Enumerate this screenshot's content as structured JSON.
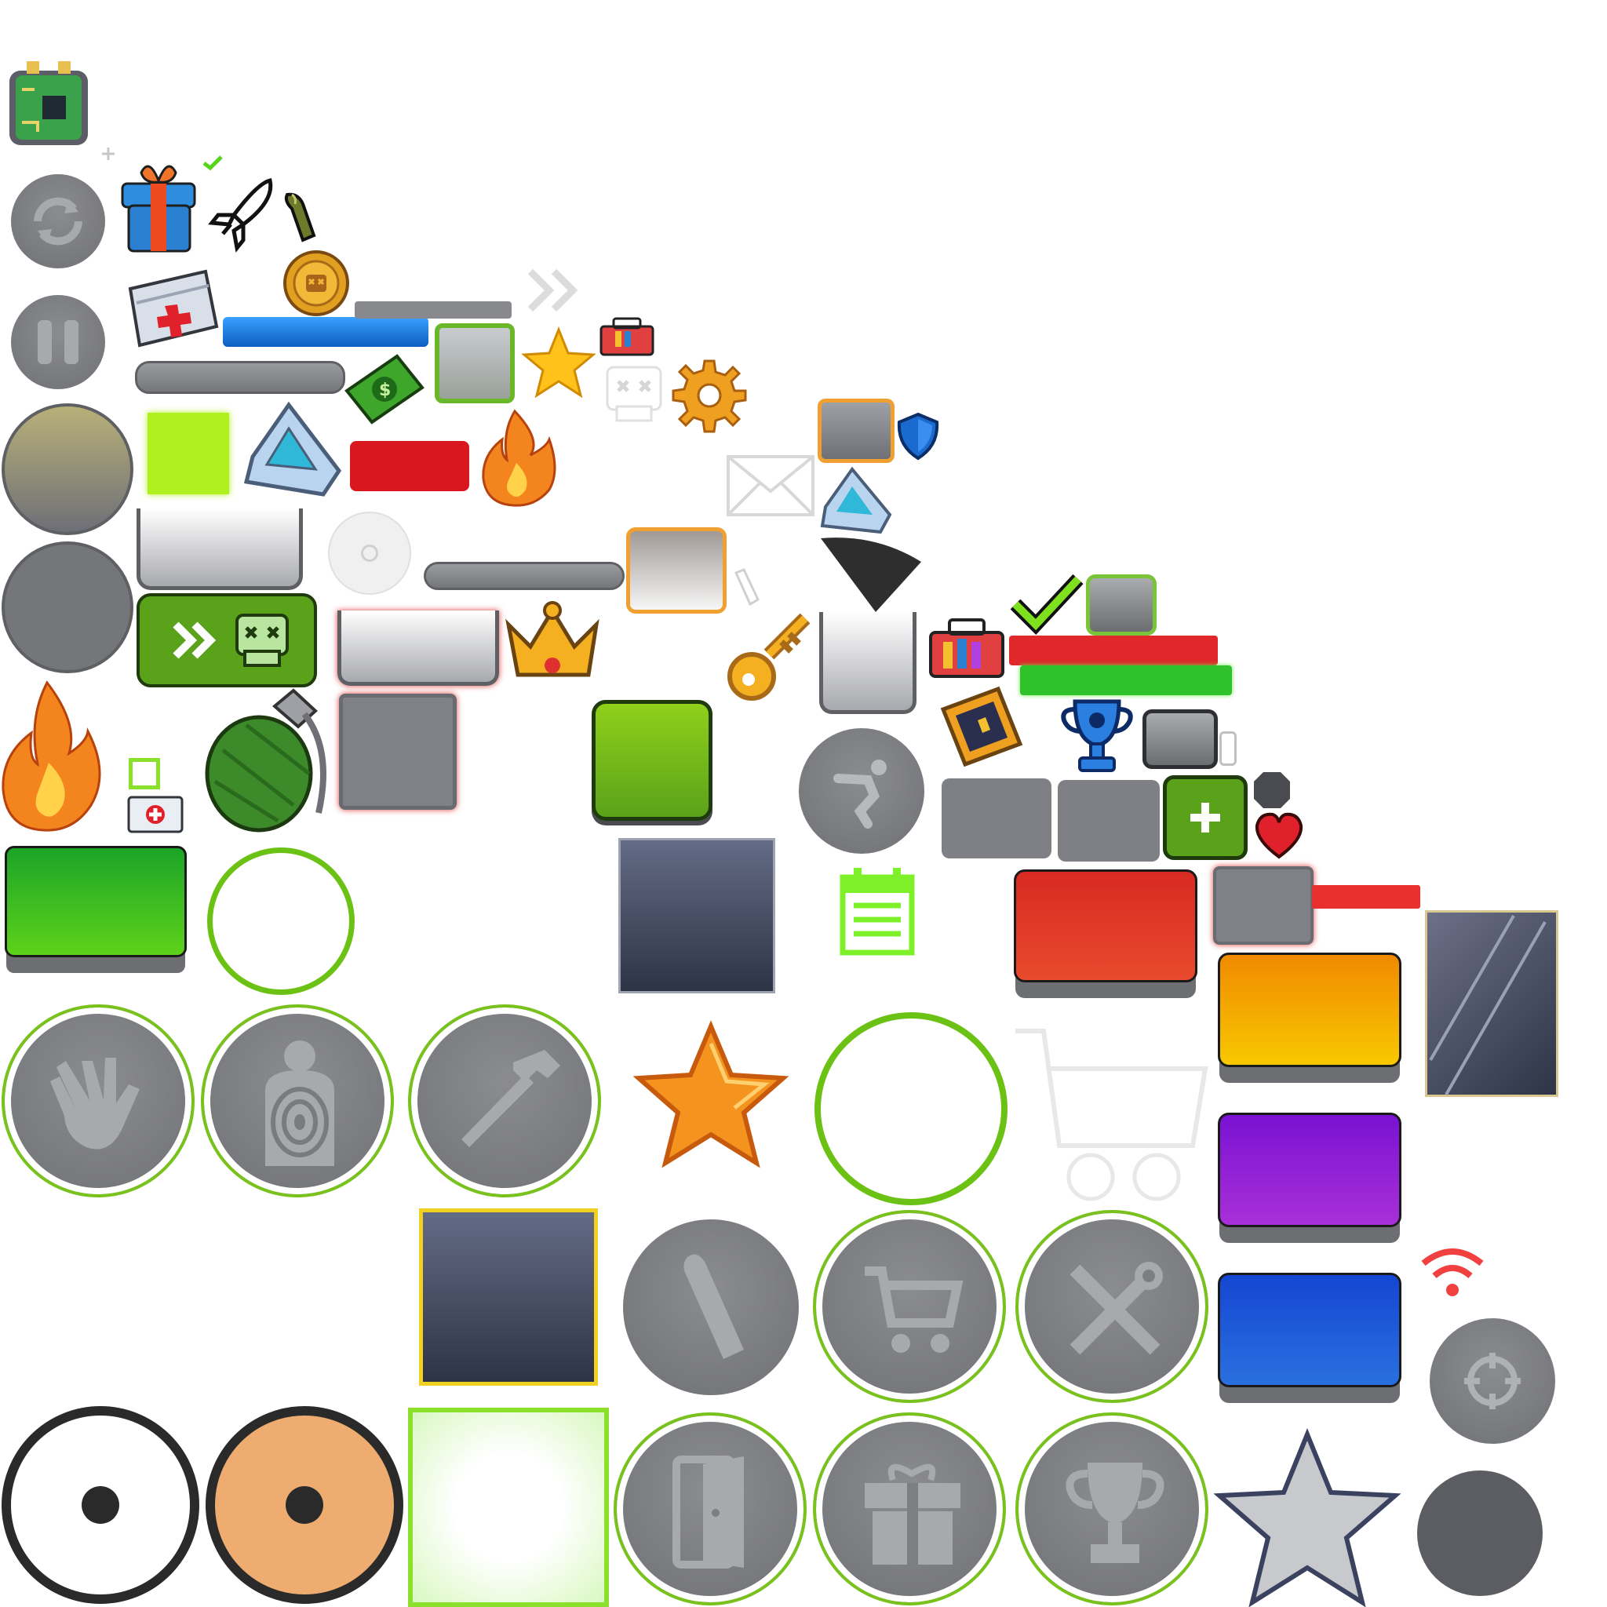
{
  "sheet": {
    "title": "",
    "colors": {
      "accent_green": "#79c21e",
      "button_grey": "#7d7e82",
      "panel_red": "#e02a22",
      "panel_orange": "#f5a300",
      "panel_purple": "#8a1fd0",
      "panel_blue": "#1c5fd6",
      "panel_green": "#2fb82a",
      "dark_slate": "#3a3f52"
    }
  },
  "icons": [
    "circuit-board-icon",
    "gift-icon",
    "rocket-icon",
    "bullet-icon",
    "checkmark-icon",
    "coin-skull-icon",
    "refresh-icon",
    "pause-icon",
    "medkit-icon",
    "blue-progress-bar",
    "grey-progress-bar",
    "cash-icon",
    "star-icon",
    "toolbox-icon",
    "skull-icon",
    "gear-icon",
    "fast-forward-icon",
    "diamond-gem-icon",
    "fire-icon",
    "shield-icon",
    "envelope-icon",
    "key-icon",
    "crown-icon",
    "grenade-icon",
    "trophy-icon",
    "ticket-icon",
    "heart-icon",
    "calendar-icon",
    "shopping-cart-icon",
    "hand-icon",
    "target-icon",
    "hammer-icon",
    "ammo-icon",
    "shop-icon",
    "tools-icon",
    "exit-door-icon",
    "present-icon",
    "cup-icon",
    "crosshair-icon",
    "wifi-icon",
    "fall-icon",
    "plus-icon"
  ]
}
